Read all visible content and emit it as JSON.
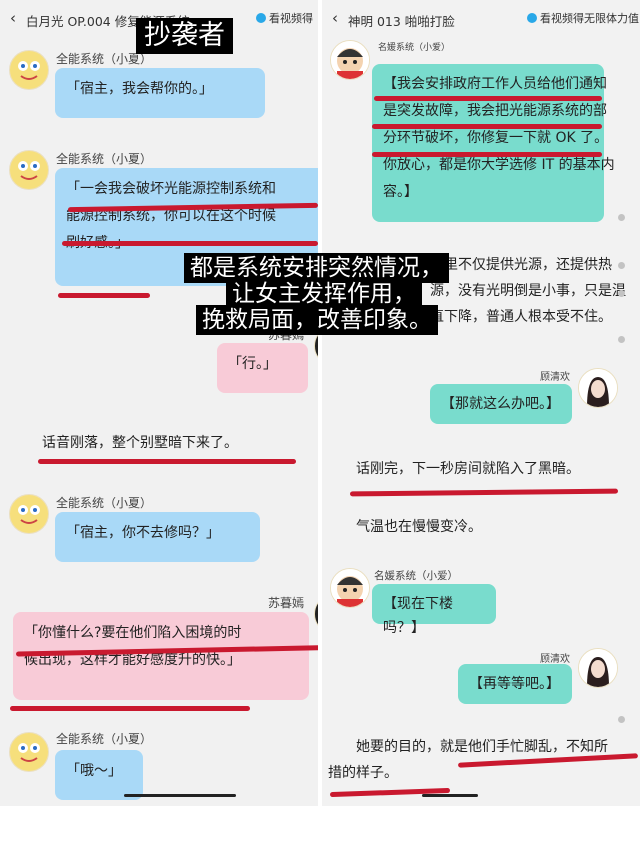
{
  "overlay_texts": {
    "title": "抄袭者",
    "line1": "都是系统安排突然情况，",
    "line2": "让女主发挥作用，",
    "line3": "挽救局面，改善印象。"
  },
  "left_panel": {
    "header": {
      "back_icon": "‹",
      "title": "白月光 OP.004 修复能源系统",
      "video_button": "看视频得"
    },
    "messages": {
      "m1_name": "全能系统（小夏）",
      "m1_text": "「宿主，我会帮你的。」",
      "m2_name": "全能系统（小夏）",
      "m2_line1": "「一会我会破坏光能源控制系统和",
      "m2_line2": "能源控制系统，你可以在这个时候",
      "m2_line3": "刷好感。」",
      "m3_name": "苏暮嫣",
      "m3_text": "「行。」",
      "narr1": "话音刚落，整个别墅暗下来了。",
      "m4_name": "全能系统（小夏）",
      "m4_text": "「宿主，你不去修吗？」",
      "m5_name": "苏暮嫣",
      "m5_line1": "「你懂什么?要在他们陷入困境的时",
      "m5_line2": "候出现，这样才能好感度升的快。」",
      "m6_name": "全能系统（小夏）",
      "m6_text": "「哦～」"
    }
  },
  "right_panel": {
    "header": {
      "back_icon": "‹",
      "title": "神明 013 啪啪打脸",
      "video_button": "看视频得无限体力值"
    },
    "messages": {
      "r1_name": "名媛系统（小爱）",
      "r1_line1": "【我会安排政府工作人员给他们通知",
      "r1_line2": "是突发故障，我会把光能源系统的部",
      "r1_line3": "分环节破坏，你修复一下就 OK 了。",
      "r1_line4": "你放心，都是你大学选修 IT 的基本内",
      "r1_line5": "容。】",
      "narr1_line1": "我们这里不仅提供光源，还提供热",
      "narr1_line2": "源，没有光明倒是小事，只是温",
      "narr1_line3": "度会一直下降，普通人根本受不住。",
      "r2_name": "顾清欢",
      "r2_text": "【那就这么办吧。】",
      "narr2": "话刚完，下一秒房间就陷入了黑暗。",
      "narr3": "气温也在慢慢变冷。",
      "r3_name": "名媛系统（小爱）",
      "r3_text": "【现在下楼吗？】",
      "r4_name": "顾清欢",
      "r4_text": "【再等等吧。】",
      "narr4_line1": "她要的目的，就是他们手忙脚乱，不知所",
      "narr4_line2": "措的样子。"
    }
  },
  "colors": {
    "blue_bubble": "#a9d9f7",
    "pink_bubble": "#f8cbd7",
    "teal_bubble": "#79dccd",
    "underline": "#c9192f"
  }
}
